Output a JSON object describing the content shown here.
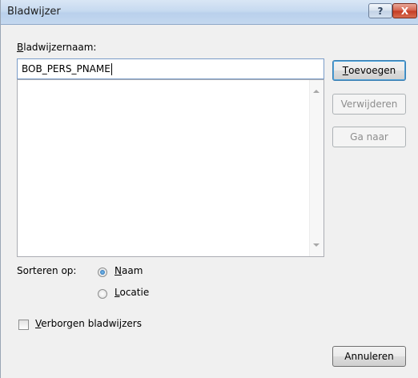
{
  "window": {
    "title": "Bladwijzer",
    "help_glyph": "?",
    "close_glyph": "X"
  },
  "name_field": {
    "label_access": "B",
    "label_rest": "ladwijzernaam:",
    "value": "BOB_PERS_PNAME"
  },
  "buttons": {
    "add_access": "T",
    "add_rest": "oevoegen",
    "remove": "Verwijderen",
    "goto": "Ga naar",
    "cancel": "Annuleren"
  },
  "sort": {
    "label": "Sorteren op:",
    "name_access": "N",
    "name_rest": "aam",
    "location_access": "L",
    "location_rest": "ocatie",
    "selected": "Naam"
  },
  "hidden_bookmarks": {
    "access": "V",
    "rest": "erborgen bladwijzers",
    "checked": false
  }
}
